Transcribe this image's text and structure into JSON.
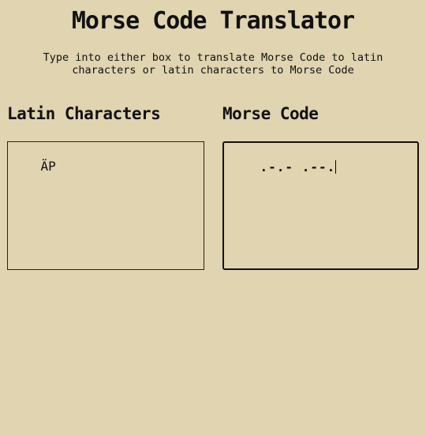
{
  "header": {
    "title": "Morse Code Translator",
    "subtitle": "Type into either box to translate Morse Code to latin characters or latin characters to Morse Code"
  },
  "latin_panel": {
    "heading": "Latin Characters",
    "value": "ÄP"
  },
  "morse_panel": {
    "heading": "Morse Code",
    "value": ".-.- .--."
  },
  "colors": {
    "background": "#e0d4b1",
    "text": "#111111"
  }
}
